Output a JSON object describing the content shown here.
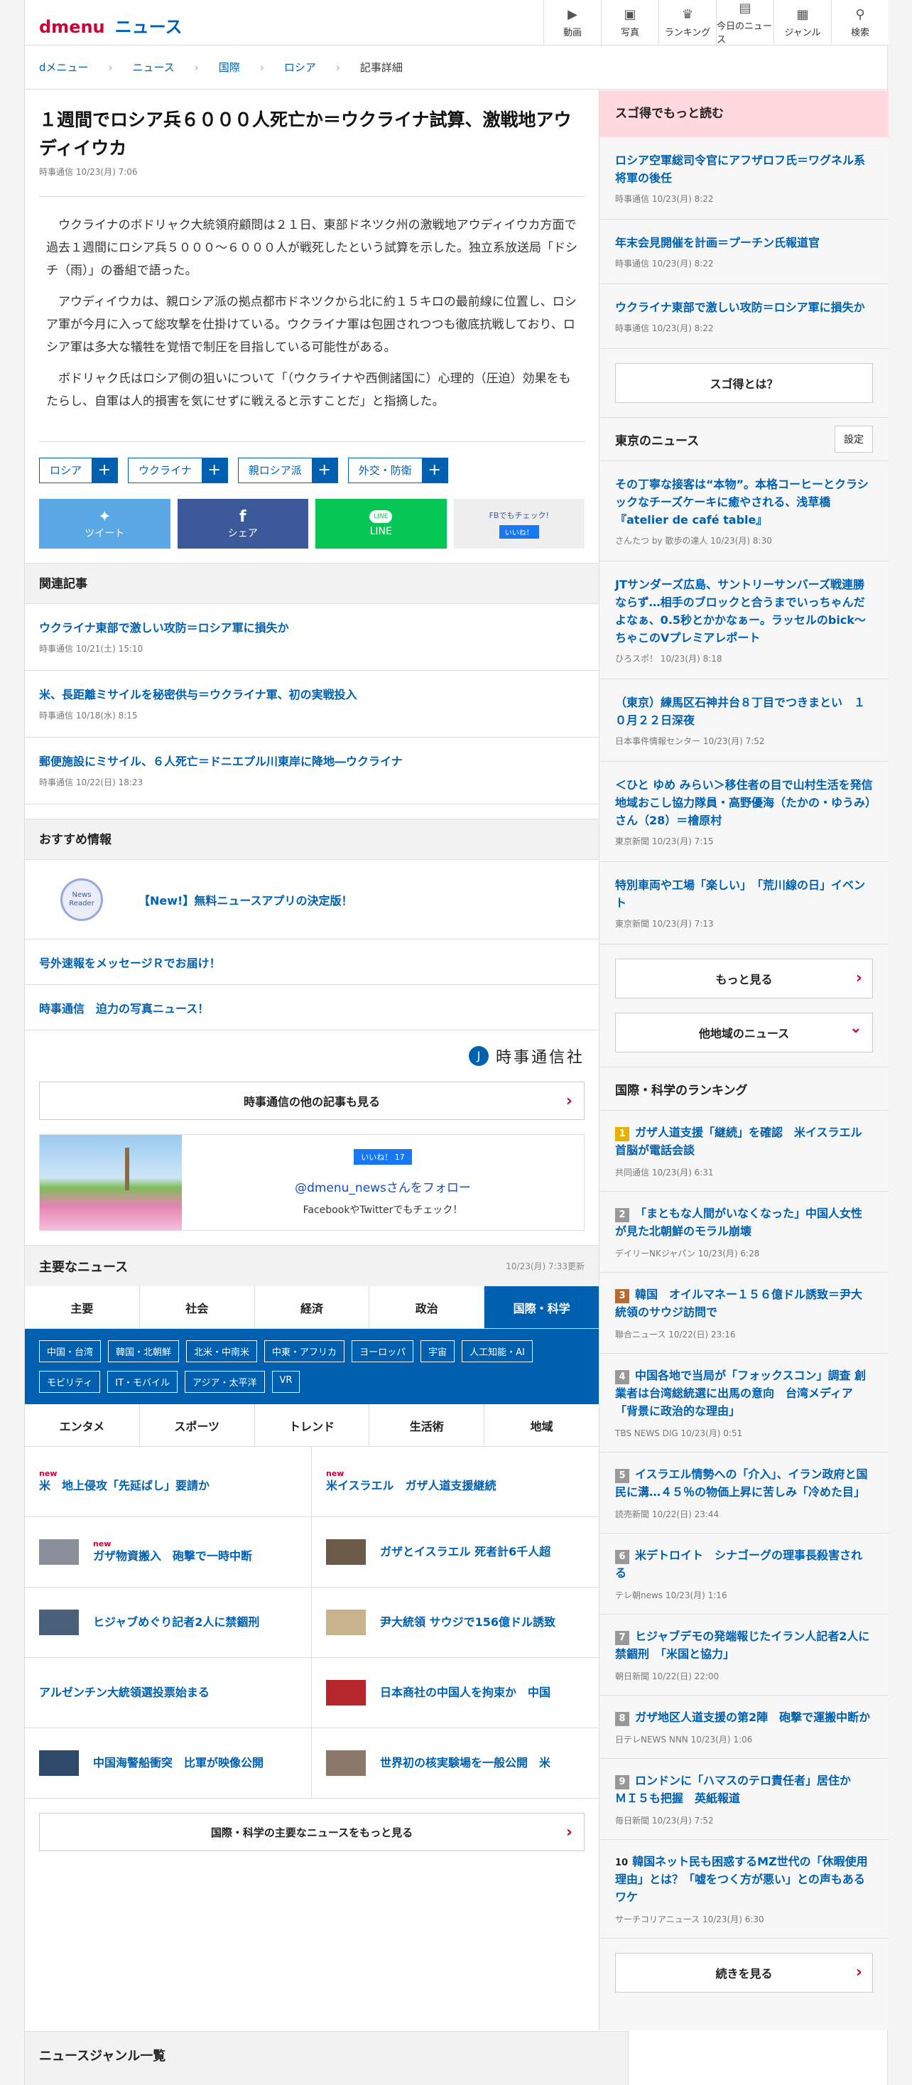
{
  "header": {
    "logo": "dmenu",
    "section": "ニュース",
    "nav": [
      {
        "icon": "video-icon",
        "glyph": "▶",
        "label": "動画"
      },
      {
        "icon": "photo-icon",
        "glyph": "▣",
        "label": "写真"
      },
      {
        "icon": "ranking-icon",
        "glyph": "♛",
        "label": "ランキング"
      },
      {
        "icon": "today-news-icon",
        "glyph": "▤",
        "label": "今日のニュース"
      },
      {
        "icon": "genre-icon",
        "glyph": "▦",
        "label": "ジャンル"
      },
      {
        "icon": "search-icon",
        "glyph": "⚲",
        "label": "検索"
      }
    ]
  },
  "breadcrumb": [
    "dメニュー",
    "ニュース",
    "国際",
    "ロシア",
    "記事詳細"
  ],
  "article": {
    "title": "１週間でロシア兵６０００人死亡か＝ウクライナ試算、激戦地アウディイウカ",
    "meta": "時事通信 10/23(月) 7:06",
    "paragraphs": [
      "ウクライナのボドリャク大統領府顧問は２１日、東部ドネツク州の激戦地アウディイウカ方面で過去１週間にロシア兵５０００～６０００人が戦死したという試算を示した。独立系放送局「ドシチ（雨）」の番組で語った。",
      "アウディイウカは、親ロシア派の拠点都市ドネツクから北に約１５キロの最前線に位置し、ロシア軍が今月に入って総攻撃を仕掛けている。ウクライナ軍は包囲されつつも徹底抗戦しており、ロシア軍は多大な犠牲を覚悟で制圧を目指している可能性がある。",
      "ボドリャク氏はロシア側の狙いについて「（ウクライナや西側諸国に）心理的（圧迫）効果をもたらし、自軍は人的損害を気にせずに戦えると示すことだ」と指摘した。"
    ],
    "tags": [
      "ロシア",
      "ウクライナ",
      "親ロシア派",
      "外交・防衛"
    ],
    "tag_plus": "+",
    "share": {
      "tweet": "ツイート",
      "share": "シェア",
      "line": "LINE",
      "line_badge": "LINE",
      "fb_check": "FBでもチェック!",
      "fb_like": "いいね！",
      "tw_glyph": "✦",
      "fb_glyph": "f"
    }
  },
  "related": {
    "heading": "関連記事",
    "items": [
      {
        "title": "ウクライナ東部で激しい攻防＝ロシア軍に損失か",
        "meta": "時事通信 10/21(土) 15:10"
      },
      {
        "title": "米、長距離ミサイルを秘密供与＝ウクライナ軍、初の実戦投入",
        "meta": "時事通信 10/18(水) 8:15"
      },
      {
        "title": "郵便施設にミサイル、６人死亡＝ドニエプル川東岸に降地―ウクライナ",
        "meta": "時事通信 10/22(日) 18:23"
      }
    ]
  },
  "recommend": {
    "heading": "おすすめ情報",
    "badge": "News Reader",
    "items": [
      "【New!】無料ニュースアプリの決定版！",
      "号外速報をメッセージＲでお届け！",
      "時事通信　迫力の写真ニュース！"
    ]
  },
  "jiji": {
    "mark": "J",
    "name": "時事通信社",
    "more": "時事通信の他の記事も見る"
  },
  "fb": {
    "like": "いいね！ 17",
    "follow": "@dmenu_newsさんをフォロー",
    "check": "FacebookやTwitterでもチェック！"
  },
  "main_news": {
    "heading": "主要なニュース",
    "updated": "10/23(月) 7:33更新",
    "tabs": [
      "主要",
      "社会",
      "経済",
      "政治",
      "国際・科学"
    ],
    "subcats": [
      "中国・台湾",
      "韓国・北朝鮮",
      "北米・中南米",
      "中東・アフリカ",
      "ヨーロッパ",
      "宇宙",
      "人工知能・AI",
      "モビリティ",
      "IT・モバイル",
      "アジア・太平洋",
      "VR"
    ],
    "tabs2": [
      "エンタメ",
      "スポーツ",
      "トレンド",
      "生活術",
      "地域"
    ],
    "new_label": "new",
    "items": [
      {
        "title": "米　地上侵攻「先延ばし」要請か",
        "new": true,
        "thumb": ""
      },
      {
        "title": "米イスラエル　ガザ人道支援継続",
        "new": true,
        "thumb": ""
      },
      {
        "title": "ガザ物資搬入　砲撃で一時中断",
        "new": true,
        "thumb": "#8a8f99"
      },
      {
        "title": "ガザとイスラエル 死者計6千人超",
        "new": false,
        "thumb": "#6b5a48"
      },
      {
        "title": "ヒジャブめぐり記者2人に禁錮刑",
        "new": false,
        "thumb": "#4a5f7a"
      },
      {
        "title": "尹大統領 サウジで156億ドル誘致",
        "new": false,
        "thumb": "#c9b38f"
      },
      {
        "title": "アルゼンチン大統領選投票始まる",
        "new": false,
        "thumb": ""
      },
      {
        "title": "日本商社の中国人を拘束か　中国",
        "new": false,
        "thumb": "#b3262b"
      },
      {
        "title": "中国海警船衝突　比軍が映像公開",
        "new": false,
        "thumb": "#2e4a6b"
      },
      {
        "title": "世界初の核実験場を一般公開　米",
        "new": false,
        "thumb": "#8c7868"
      }
    ],
    "more": "国際・科学の主要なニュースをもっと見る"
  },
  "sidebar": {
    "sugotoku": {
      "heading": "スゴ得でもっと読む",
      "items": [
        {
          "title": "ロシア空軍総司令官にアフザロフ氏＝ワグネル系将軍の後任",
          "meta": "時事通信 10/23(月) 8:22"
        },
        {
          "title": "年末会見開催を計画＝プーチン氏報道官",
          "meta": "時事通信 10/23(月) 8:22"
        },
        {
          "title": "ウクライナ東部で激しい攻防＝ロシア軍に損失か",
          "meta": "時事通信 10/23(月) 8:22"
        }
      ],
      "button": "スゴ得とは？"
    },
    "tokyo": {
      "heading": "東京のニュース",
      "settings": "設定",
      "items": [
        {
          "title": "その丁寧な接客は“本物”。本格コーヒーとクラシックなチーズケーキに癒やされる、浅草橋『atelier de café table』",
          "meta": "さんたつ by 散歩の達人 10/23(月) 8:30"
        },
        {
          "title": "JTサンダーズ広島、サントリーサンバーズ戦連勝ならず…相手のブロックと合うまでいっちゃんだよなぁ、0.5秒とかかなぁー。ラッセルのbick～ちゃこのVプレミアレポート",
          "meta": "ひろスポ！ 10/23(月) 8:18"
        },
        {
          "title": "（東京）練馬区石神井台８丁目でつきまとい　１０月２２日深夜",
          "meta": "日本事件情報センター 10/23(月) 7:52"
        },
        {
          "title": "＜ひと ゆめ みらい＞移住者の目で山村生活を発信 地域おこし協力隊員・高野優海（たかの・ゆうみ）さん（28）＝檜原村",
          "meta": "東京新聞 10/23(月) 7:15"
        },
        {
          "title": "特別車両や工場「楽しい」　「荒川線の日」イベント",
          "meta": "東京新聞 10/23(月) 7:13"
        }
      ],
      "more": "もっと見る",
      "other": "他地域のニュース"
    },
    "ranking": {
      "heading": "国際・科学のランキング",
      "items": [
        {
          "n": "1",
          "title": "ガザ人道支援「継続」を確認　米イスラエル首脳が電話会談",
          "meta": "共同通信 10/23(月) 6:31"
        },
        {
          "n": "2",
          "title": "「まともな人間がいなくなった」中国人女性が見た北朝鮮のモラル崩壊",
          "meta": "デイリーNKジャパン 10/23(月) 6:28"
        },
        {
          "n": "3",
          "title": "韓国　オイルマネー１５６億ドル誘致＝尹大統領のサウジ訪問で",
          "meta": "聯合ニュース 10/22(日) 23:16"
        },
        {
          "n": "4",
          "title": "中国各地で当局が「フォックスコン」調査 創業者は台湾総統選に出馬の意向　台湾メディア「背景に政治的な理由」",
          "meta": "TBS NEWS DIG 10/23(月) 0:51"
        },
        {
          "n": "5",
          "title": "イスラエル情勢への「介入」、イラン政府と国民に溝…４５％の物価上昇に苦しみ「冷めた目」",
          "meta": "読売新聞 10/22(日) 23:44"
        },
        {
          "n": "6",
          "title": "米デトロイト　シナゴーグの理事長殺害される",
          "meta": "テレ朝news 10/23(月) 1:16"
        },
        {
          "n": "7",
          "title": "ヒジャブデモの発端報じたイラン人記者2人に禁錮刑　「米国と協力」",
          "meta": "朝日新聞 10/22(日) 22:00"
        },
        {
          "n": "8",
          "title": "ガザ地区人道支援の第2陣　砲撃で運搬中断か",
          "meta": "日テレNEWS NNN 10/23(月) 1:06"
        },
        {
          "n": "9",
          "title": "ロンドンに「ハマスのテロ責任者」居住か　ＭＩ５も把握　英紙報道",
          "meta": "毎日新聞 10/23(月) 7:52"
        },
        {
          "n": "10",
          "title": "韓国ネット民も困惑するMZ世代の「休暇使用理由」とは？「嘘をつく方が悪い」との声もあるワケ",
          "meta": "サーチコリアニュース 10/23(月) 6:30"
        }
      ],
      "more": "続きを見る"
    }
  },
  "genre": {
    "heading": "ニュースジャンル一覧"
  },
  "chevron": "›",
  "chevron_down": "⌄"
}
